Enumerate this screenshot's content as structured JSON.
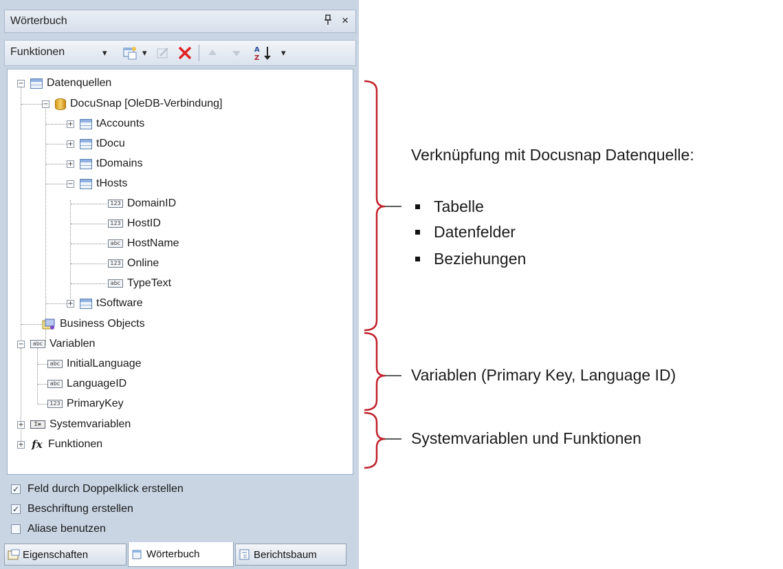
{
  "panel": {
    "title": "Wörterbuch",
    "pin_glyph": "Ȩ",
    "close_glyph": "×",
    "toolbar": {
      "functions_label": "Funktionen",
      "dropdown_glyph": "▾",
      "sort_glyph": "A↓Z"
    },
    "tree": [
      {
        "label": "Datenquellen",
        "icon": "table-icon"
      },
      {
        "label": "DocuSnap [OleDB-Verbindung]",
        "icon": "database-icon"
      },
      {
        "label": "tAccounts",
        "icon": "table-icon"
      },
      {
        "label": "tDocu",
        "icon": "table-icon"
      },
      {
        "label": "tDomains",
        "icon": "table-icon"
      },
      {
        "label": "tHosts",
        "icon": "table-icon"
      },
      {
        "label": "DomainID",
        "icon": "number-field-icon",
        "badge": "123"
      },
      {
        "label": "HostID",
        "icon": "number-field-icon",
        "badge": "123"
      },
      {
        "label": "HostName",
        "icon": "text-field-icon",
        "badge": "abc"
      },
      {
        "label": "Online",
        "icon": "number-field-icon",
        "badge": "123"
      },
      {
        "label": "TypeText",
        "icon": "text-field-icon",
        "badge": "abc"
      },
      {
        "label": "tSoftware",
        "icon": "table-icon"
      },
      {
        "label": "Business Objects",
        "icon": "business-objects-icon"
      },
      {
        "label": "Variablen",
        "icon": "variables-icon",
        "badge": "abc"
      },
      {
        "label": "InitialLanguage",
        "icon": "text-field-icon",
        "badge": "abc"
      },
      {
        "label": "LanguageID",
        "icon": "text-field-icon",
        "badge": "abc"
      },
      {
        "label": "PrimaryKey",
        "icon": "number-field-icon",
        "badge": "123"
      },
      {
        "label": "Systemvariablen",
        "icon": "system-variables-icon",
        "badge": "Σ≡"
      },
      {
        "label": "Funktionen",
        "icon": "function-icon",
        "badge": "fx"
      }
    ],
    "options": [
      {
        "label": "Feld durch Doppelklick erstellen",
        "checked": true
      },
      {
        "label": "Beschriftung erstellen",
        "checked": true
      },
      {
        "label": "Aliase benutzen",
        "checked": false
      }
    ],
    "check_glyph": "✓",
    "tabs": [
      {
        "label": "Eigenschaften",
        "active": false
      },
      {
        "label": "Wörterbuch",
        "active": true
      },
      {
        "label": "Berichtsbaum",
        "active": false
      }
    ]
  },
  "annotations": {
    "datasource_heading": "Verknüpfung mit Docusnap Datenquelle:",
    "datasource_items": [
      "Tabelle",
      "Datenfelder",
      "Beziehungen"
    ],
    "variables_note": "Variablen (Primary Key, Language ID)",
    "system_note": "Systemvariablen und Funktionen",
    "bracket_color": "#c0202a"
  }
}
